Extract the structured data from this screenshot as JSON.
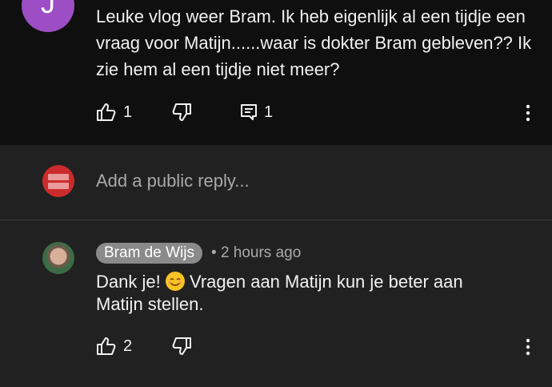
{
  "comment": {
    "avatar_letter": "J",
    "text": "Leuke vlog weer Bram. Ik heb eigenlijk al een tijdje een vraag voor Matijn......waar is dokter Bram gebleven?? Ik zie hem al een tijdje niet meer?",
    "likes": "1",
    "replies": "1"
  },
  "reply_input": {
    "placeholder": "Add a public reply..."
  },
  "reply": {
    "author": "Bram de Wijs",
    "separator": "•",
    "time": "2 hours ago",
    "text_before_emoji": "Dank je!",
    "text_after_emoji": "Vragen aan Matijn kun je beter aan Matijn stellen.",
    "likes": "2"
  },
  "colors": {
    "background": "#0f0f0f",
    "panel": "#212121",
    "avatar_j": "#9d4ec4",
    "avatar_me": "#cc2b2b",
    "chip": "#8a8a8a"
  }
}
